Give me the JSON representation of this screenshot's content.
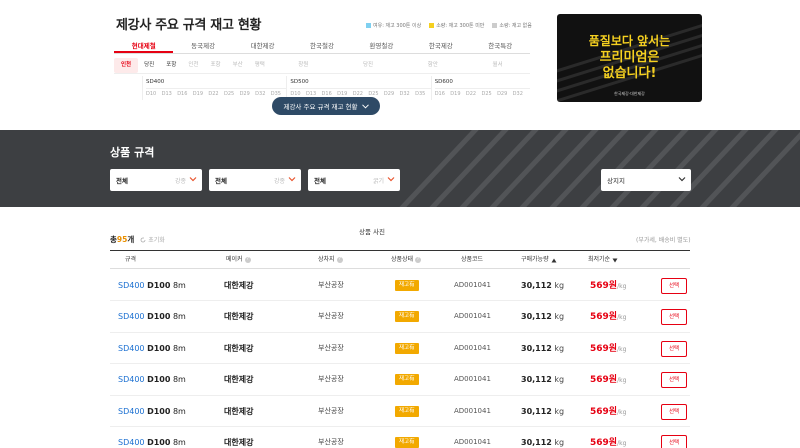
{
  "inventory": {
    "title": "제강사 주요 규격 재고 현황",
    "legend": [
      {
        "label": "여유: 재고 300톤 이상",
        "color": "#7fd0f0"
      },
      {
        "label": "소량: 재고 300톤 미만",
        "color": "#f5d020"
      },
      {
        "label": "소량: 재고 없음",
        "color": "#cccccc"
      }
    ],
    "mill_tabs": [
      "현대제철",
      "동국제강",
      "대한제강",
      "한국철강",
      "환영철강",
      "한국제강",
      "한국특강"
    ],
    "plant_tabs": [
      {
        "label": "인천",
        "state": "active"
      },
      {
        "label": "당진",
        "state": "on"
      },
      {
        "label": "포항",
        "state": "on"
      },
      {
        "label": "인천",
        "state": "off"
      },
      {
        "label": "포항",
        "state": "off"
      },
      {
        "label": "부산",
        "state": "off"
      },
      {
        "label": "평택",
        "state": "off"
      },
      {
        "label": "창원",
        "state": "off"
      },
      {
        "label": "당진",
        "state": "off"
      },
      {
        "label": "함안",
        "state": "off"
      },
      {
        "label": "월서",
        "state": "off"
      }
    ],
    "grades": [
      {
        "name": "SD400",
        "dias": [
          "D10",
          "D13",
          "D16",
          "D19",
          "D22",
          "D25",
          "D29",
          "D32",
          "D35"
        ]
      },
      {
        "name": "SD500",
        "dias": [
          "D10",
          "D13",
          "D16",
          "D19",
          "D22",
          "D25",
          "D29",
          "D32",
          "D35"
        ]
      },
      {
        "name": "SD600",
        "dias": [
          "D16",
          "D19",
          "D22",
          "D25",
          "D29",
          "D32"
        ]
      }
    ],
    "spec_button": "제강사 주요 규격 재고 현황"
  },
  "banner": {
    "line1": "품질보다 앞서는",
    "line2": "프리미엄은",
    "line3": "없습니다!",
    "footer": "한국제강·대한제강"
  },
  "search": {
    "title": "상품 규격",
    "filters": [
      {
        "value": "전체",
        "placeholder": "강종"
      },
      {
        "value": "전체",
        "placeholder": "강종"
      },
      {
        "value": "전체",
        "placeholder": "굵기"
      }
    ],
    "location": "상지지"
  },
  "results": {
    "photo_label": "상품 사진",
    "total_prefix": "총",
    "total_count": "95",
    "total_suffix": "개",
    "reset_label": "초기화",
    "note": "(부가세, 배송비 별도)",
    "columns": [
      "규격",
      "메이커",
      "상차지",
      "상품상태",
      "상품코드",
      "구매가능량",
      "최저기순"
    ],
    "rows": [
      {
        "grade": "SD400",
        "dia": "D100",
        "len": "8m",
        "maker": "대한제강",
        "loc": "부산공장",
        "status": "재고有",
        "code": "AD001041",
        "qty": "30,112",
        "qty_unit": "kg",
        "price": "569원",
        "price_unit": "/kg",
        "action": "선택"
      },
      {
        "grade": "SD400",
        "dia": "D100",
        "len": "8m",
        "maker": "대한제강",
        "loc": "부산공장",
        "status": "재고有",
        "code": "AD001041",
        "qty": "30,112",
        "qty_unit": "kg",
        "price": "569원",
        "price_unit": "/kg",
        "action": "선택"
      },
      {
        "grade": "SD400",
        "dia": "D100",
        "len": "8m",
        "maker": "대한제강",
        "loc": "부산공장",
        "status": "재고有",
        "code": "AD001041",
        "qty": "30,112",
        "qty_unit": "kg",
        "price": "569원",
        "price_unit": "/kg",
        "action": "선택"
      },
      {
        "grade": "SD400",
        "dia": "D100",
        "len": "8m",
        "maker": "대한제강",
        "loc": "부산공장",
        "status": "재고有",
        "code": "AD001041",
        "qty": "30,112",
        "qty_unit": "kg",
        "price": "569원",
        "price_unit": "/kg",
        "action": "선택"
      },
      {
        "grade": "SD400",
        "dia": "D100",
        "len": "8m",
        "maker": "대한제강",
        "loc": "부산공장",
        "status": "재고有",
        "code": "AD001041",
        "qty": "30,112",
        "qty_unit": "kg",
        "price": "569원",
        "price_unit": "/kg",
        "action": "선택"
      },
      {
        "grade": "SD400",
        "dia": "D100",
        "len": "8m",
        "maker": "대한제강",
        "loc": "부산공장",
        "status": "재고有",
        "code": "AD001041",
        "qty": "30,112",
        "qty_unit": "kg",
        "price": "569원",
        "price_unit": "/kg",
        "action": "선택"
      }
    ]
  }
}
